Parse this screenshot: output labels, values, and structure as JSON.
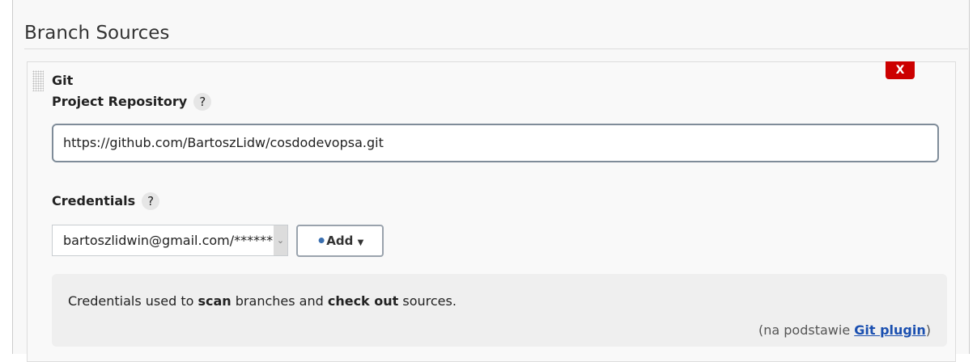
{
  "section_title": "Branch Sources",
  "source": {
    "type": "Git",
    "delete_label": "X",
    "repo_label": "Project Repository",
    "repo_url": "https://github.com/BartoszLidw/cosdodevopsa.git",
    "credentials_label": "Credentials",
    "credentials_value": "bartoszlidwin@gmail.com/******",
    "add_label": "Add",
    "help": "?",
    "info": {
      "p1": "Credentials used to ",
      "b1": "scan",
      "p2": " branches and ",
      "b2": "check out",
      "p3": " sources.",
      "by_prefix": "(na podstawie ",
      "by_link": "Git plugin",
      "by_suffix": ")"
    }
  },
  "colors": {
    "delete": "#cc0000",
    "link": "#1a4fb0"
  }
}
